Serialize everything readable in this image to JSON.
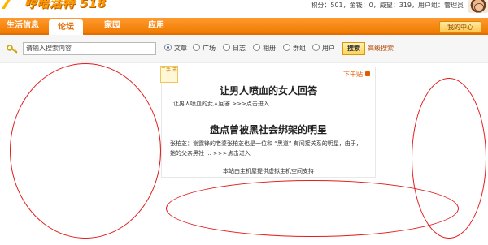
{
  "header": {
    "logo_mark": "7",
    "logo_text": "哼哈活特 518",
    "logo_url": "www.hhht518.com",
    "userbar": "积分：501，金钱：0，威望：319，用户组：管理员",
    "avatar_icon": "avatar-icon"
  },
  "nav": {
    "tabs": [
      {
        "label": "生活信息",
        "active": false
      },
      {
        "label": "论坛",
        "active": true
      },
      {
        "label": "家园",
        "active": false
      },
      {
        "label": "应用",
        "active": false
      }
    ],
    "my_center": "我的中心"
  },
  "search": {
    "icon": "key-icon",
    "placeholder": "请输入搜索内容",
    "options": [
      {
        "label": "文章",
        "checked": true
      },
      {
        "label": "广场",
        "checked": false
      },
      {
        "label": "日志",
        "checked": false
      },
      {
        "label": "相册",
        "checked": false
      },
      {
        "label": "群组",
        "checked": false
      },
      {
        "label": "用户",
        "checked": false
      }
    ],
    "button": "搜索",
    "advanced": "高级搜索"
  },
  "card": {
    "ribbon": "二手 市",
    "tag": "下午贴",
    "headline1": "让男人喷血的女人回答",
    "sub1": "让男人喷血的女人回答",
    "sub1_more": ">>>点击进入",
    "headline2": "盘点曾被黑社会绑架的明星",
    "excerpt_line1": "张柏芝：谢霆锋的老婆张柏芝也是一位和 “黑道” 有间接关系的明星，由于，",
    "excerpt_line2": "她的父亲黑社 ...",
    "excerpt_more": ">>>点击进入",
    "sponsor": "本站由主机屋提供虚拟主机空间支持"
  },
  "colors": {
    "nav_orange": "#f07a00",
    "annotation_red": "#e21d1d"
  }
}
